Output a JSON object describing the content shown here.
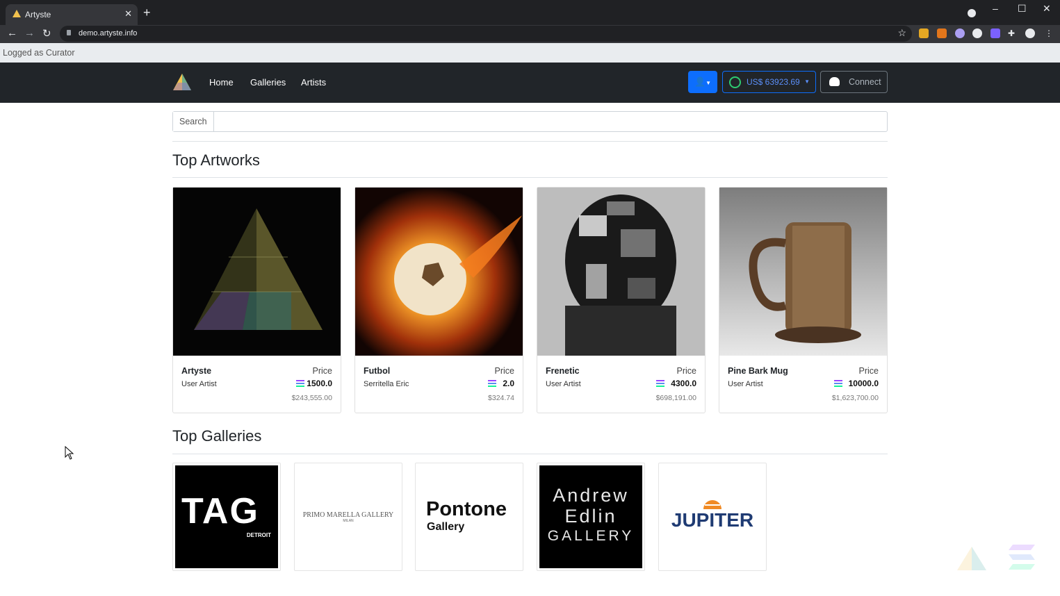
{
  "browser": {
    "tab_title": "Artyste",
    "url": "demo.artyste.info"
  },
  "login_status": "Logged as Curator",
  "nav": {
    "links": [
      "Home",
      "Galleries",
      "Artists"
    ],
    "balance": "US$ 63923.69",
    "connect": "Connect"
  },
  "search": {
    "label": "Search"
  },
  "sections": {
    "top_artworks": "Top Artworks",
    "top_galleries": "Top Galleries"
  },
  "artworks": [
    {
      "name": "Artyste",
      "artist": "User Artist",
      "price_label": "Price",
      "price": "1500.0",
      "usd": "$243,555.00"
    },
    {
      "name": "Futbol",
      "artist": "Serritella Eric",
      "price_label": "Price",
      "price": "2.0",
      "usd": "$324.74"
    },
    {
      "name": "Frenetic",
      "artist": "User Artist",
      "price_label": "Price",
      "price": "4300.0",
      "usd": "$698,191.00"
    },
    {
      "name": "Pine Bark Mug",
      "artist": "User Artist",
      "price_label": "Price",
      "price": "10000.0",
      "usd": "$1,623,700.00"
    }
  ],
  "galleries": [
    {
      "logo_text": "TAG",
      "logo_sub": "DETROIT"
    },
    {
      "logo_text": "PRIMO MARELLA GALLERY",
      "logo_sub": "MILAN"
    },
    {
      "logo_text": "Pontone",
      "logo_sub": "Gallery"
    },
    {
      "logo_text": "Andrew",
      "logo_line2": "Edlin",
      "logo_sub": "GALLERY"
    },
    {
      "logo_text": "JUPITER"
    }
  ]
}
